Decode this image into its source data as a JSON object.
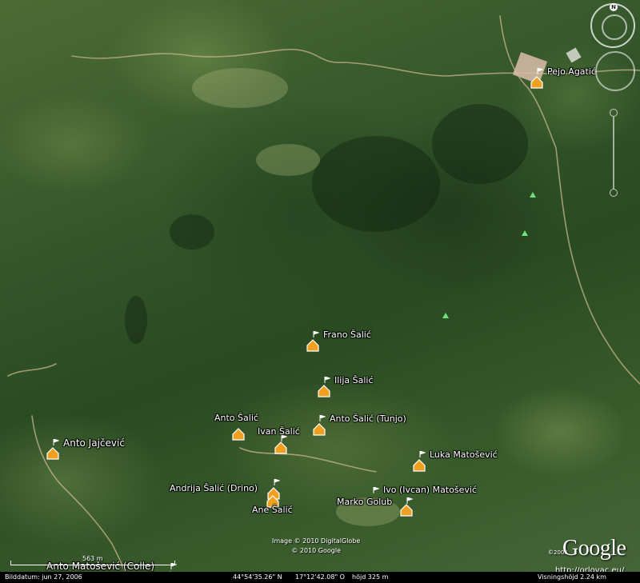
{
  "placemarks": [
    {
      "id": "pejo-agatic",
      "label": "Pejo Agatić"
    },
    {
      "id": "frano-salic",
      "label": "Frano Šalić"
    },
    {
      "id": "ilija-salic",
      "label": "Ilija Šalić"
    },
    {
      "id": "anto-salic",
      "label": "Anto Šalić"
    },
    {
      "id": "anto-salic-tunjo",
      "label": "Anto Šalić (Tunjo)"
    },
    {
      "id": "ivan-salic",
      "label": "Ivan Šalić"
    },
    {
      "id": "anto-jajcevic",
      "label": "Anto Jajčević"
    },
    {
      "id": "luka-matosevic",
      "label": "Luka Matošević"
    },
    {
      "id": "andrija-salic-drino",
      "label": "Andrija Šalić (Drino)"
    },
    {
      "id": "ane-salic",
      "label": "Ane Šalić"
    },
    {
      "id": "ivo-ivcan-matosevic",
      "label": "Ivo (Ivcan) Matošević"
    },
    {
      "id": "marko-golub",
      "label": "Marko Golub"
    },
    {
      "id": "anto-matosevic-colle",
      "label": "Anto Matošević (Colle)"
    }
  ],
  "navigation": {
    "compass_north": "N"
  },
  "scale": {
    "label": "563 m"
  },
  "credits": {
    "line1": "Image © 2010 DigitalGlobe",
    "line2": "© 2010 Google"
  },
  "logo": {
    "text": "Google",
    "year": "©2008"
  },
  "watermark_url": "http://orlovac.eu/",
  "status": {
    "image_date": "Bilddatum: jun 27, 2006",
    "lat": "44°54'35.26\" N",
    "lon": "17°12'42.08\" O",
    "elevation": "höjd  325 m",
    "eye_alt": "Visningshöjd   2.24 km"
  },
  "colors": {
    "placemark": "#f0a020",
    "label_text": "#ffffff",
    "triangle": "#6fe07a"
  }
}
